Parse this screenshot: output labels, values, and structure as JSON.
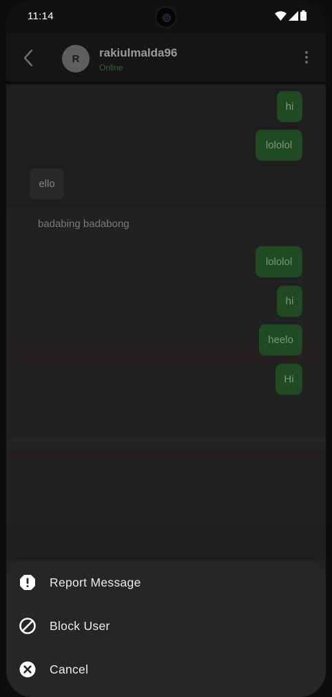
{
  "status_bar": {
    "time": "11:14"
  },
  "header": {
    "avatar_initial": "R",
    "username": "rakiulmalda96",
    "presence": "Online"
  },
  "messages": [
    {
      "direction": "outgoing",
      "text": "hi"
    },
    {
      "direction": "outgoing",
      "text": "lololol"
    },
    {
      "direction": "incoming",
      "text": "ello"
    },
    {
      "direction": "incoming-plain",
      "text": "badabing badabong"
    },
    {
      "direction": "outgoing",
      "text": "lololol"
    },
    {
      "direction": "outgoing",
      "text": "hi"
    },
    {
      "direction": "outgoing",
      "text": "heelo"
    },
    {
      "direction": "outgoing",
      "text": "Hi"
    }
  ],
  "action_sheet": {
    "items": [
      {
        "label": "Report Message",
        "icon": "alert-octagon-icon"
      },
      {
        "label": "Block User",
        "icon": "block-icon"
      },
      {
        "label": "Cancel",
        "icon": "close-circle-icon"
      }
    ]
  },
  "colors": {
    "outgoing_bubble": "#1f4a22",
    "online": "#2f6b2f",
    "sheet_background": "#262626"
  }
}
